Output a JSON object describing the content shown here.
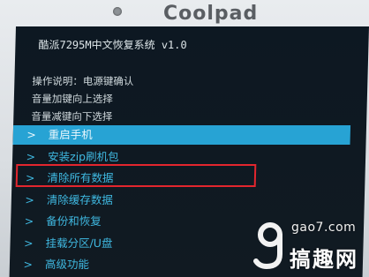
{
  "device": {
    "brand": "Coolpad"
  },
  "recovery": {
    "title": "酷派7295M中文恢复系统 v1.0",
    "help": [
      "操作说明：电源键确认",
      "音量加键向上选择",
      "音量减键向下选择"
    ],
    "menu": [
      {
        "label": "重启手机",
        "selected": true
      },
      {
        "label": "安装zip刷机包",
        "selected": false
      },
      {
        "label": "清除所有数据",
        "selected": false,
        "highlighted": true
      },
      {
        "label": "清除缓存数据",
        "selected": false
      },
      {
        "label": "备份和恢复",
        "selected": false
      },
      {
        "label": "挂载分区/U盘",
        "selected": false
      },
      {
        "label": "高级功能",
        "selected": false
      }
    ],
    "arrow": ">"
  },
  "watermark": {
    "domain": "gao7.com",
    "name": "搞趣网"
  },
  "colors": {
    "screen_bg": "#0f1821",
    "menu_text": "#3fb8e0",
    "selected_bg": "#27a3d4",
    "highlight_border": "#e3262e"
  }
}
